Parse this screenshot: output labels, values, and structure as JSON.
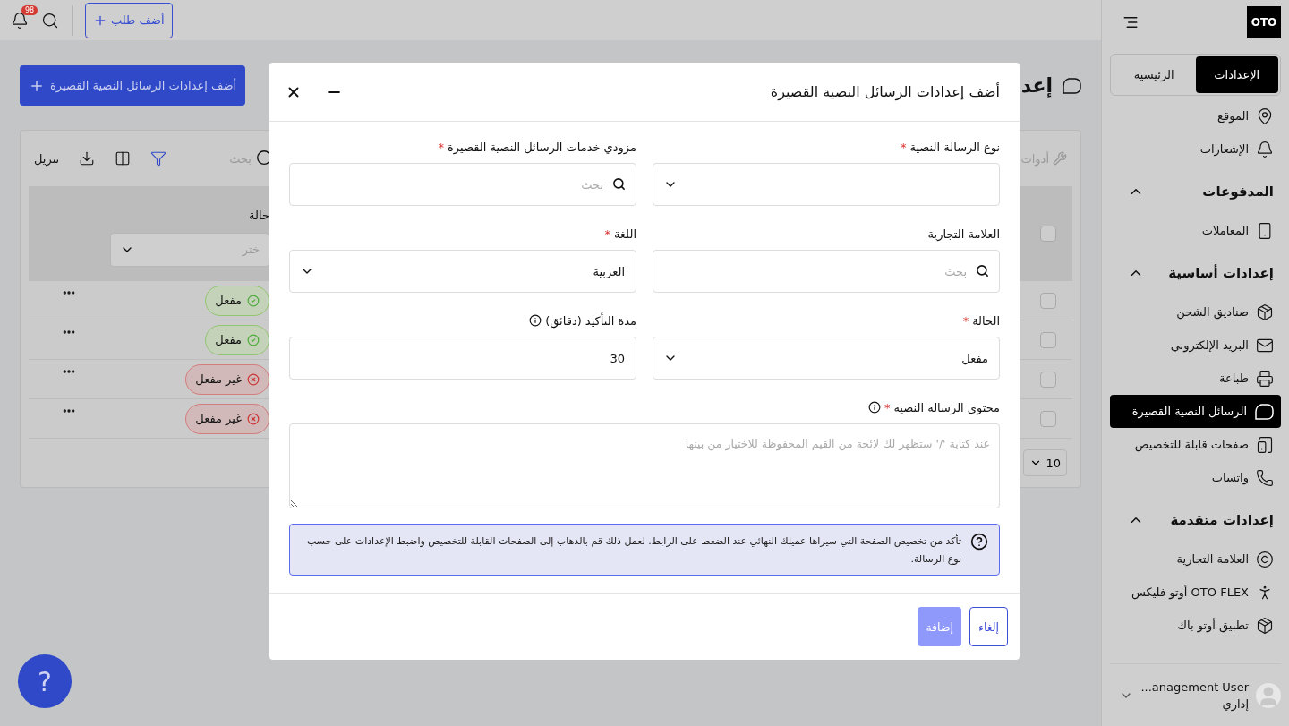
{
  "header": {
    "notification_count": "98",
    "add_order_button": "أضف طلب"
  },
  "page": {
    "title": "إعد",
    "add_button": "أضف إعدادات الرسائل النصية القصيرة"
  },
  "toolbar": {
    "tools": "أدوات",
    "search_placeholder": "بحث",
    "download": "تنزيل"
  },
  "table": {
    "status_column": "حالة",
    "status_filter_placeholder": "ختر",
    "header_checked": false,
    "rows": [
      {
        "status": "مفعل",
        "kind": "enabled",
        "checked": false
      },
      {
        "status": "مفعل",
        "kind": "enabled",
        "checked": false
      },
      {
        "status": "غير مفعل",
        "kind": "disabled",
        "checked": false
      },
      {
        "status": "غير مفعل",
        "kind": "disabled",
        "checked": false
      }
    ],
    "page_size": "10"
  },
  "help_button": "?",
  "sidebar": {
    "logo": "OTO",
    "tabs": [
      {
        "label": "الإعدادات",
        "selected": true
      },
      {
        "label": "الرئيسية",
        "selected": false
      }
    ],
    "items": [
      {
        "label": "الموقع",
        "selected": false
      },
      {
        "label": "الإشعارات",
        "selected": false
      }
    ],
    "sections": [
      {
        "title": "المدفوعات",
        "expanded": true,
        "items": [
          {
            "label": "المعاملات",
            "selected": false
          }
        ]
      },
      {
        "title": "إعدادات أساسية",
        "expanded": true,
        "items": [
          {
            "label": "صناديق الشحن",
            "selected": false
          },
          {
            "label": "البريد الإلكتروني",
            "selected": false
          },
          {
            "label": "طباعة",
            "selected": false
          },
          {
            "label": "الرسائل النصية القصيرة",
            "selected": true
          },
          {
            "label": "صفحات قابلة للتخصيص",
            "selected": false
          },
          {
            "label": "واتساب",
            "selected": false
          }
        ]
      },
      {
        "title": "إعدادات متقدمة",
        "expanded": true,
        "items": [
          {
            "label": "العلامة التجارية",
            "selected": false
          },
          {
            "label": "أوتو فليكس OTO FLEX",
            "selected": false
          },
          {
            "label": "تطبيق أوتو باك",
            "selected": false
          }
        ]
      }
    ],
    "user": {
      "name": "...anagement User",
      "role": "إداري"
    }
  },
  "modal": {
    "title": "أضف إعدادات الرسائل النصية القصيرة",
    "required_mark": "*",
    "fields": [
      {
        "label": "نوع الرسالة النصية",
        "required": true,
        "kind": "select"
      },
      {
        "label": "مزودي خدمات الرسائل النصية القصيرة",
        "required": true,
        "kind": "search",
        "placeholder": "بحث"
      },
      {
        "label": "العلامة التجارية",
        "required": false,
        "kind": "search",
        "placeholder": "بحث"
      },
      {
        "label": "اللغة",
        "required": true,
        "kind": "select",
        "value": "العربية"
      },
      {
        "label": "الحالة",
        "required": true,
        "kind": "select",
        "value": "مفعل"
      },
      {
        "label": "مدة التأكيد (دقائق)",
        "required": false,
        "kind": "input",
        "value": "30",
        "info": true
      }
    ],
    "content": {
      "label": "محتوى الرسالة النصية",
      "required": true,
      "info": true,
      "placeholder": "عند كتابة '/' ستظهر لك لائحة من القيم المحفوظة للاختيار من بينها"
    },
    "note": "تأكد من تخصيص الصفحة التي سيراها عميلك النهائي عند الضغط على الرابط. لعمل ذلك قم بالذهاب إلى الصفحات القابلة للتخصيص واضبط الإعدادات على حسب نوع الرسالة.",
    "cancel_button": "إلغاء",
    "add_button": {
      "label": "إضافة",
      "disabled": true
    }
  }
}
